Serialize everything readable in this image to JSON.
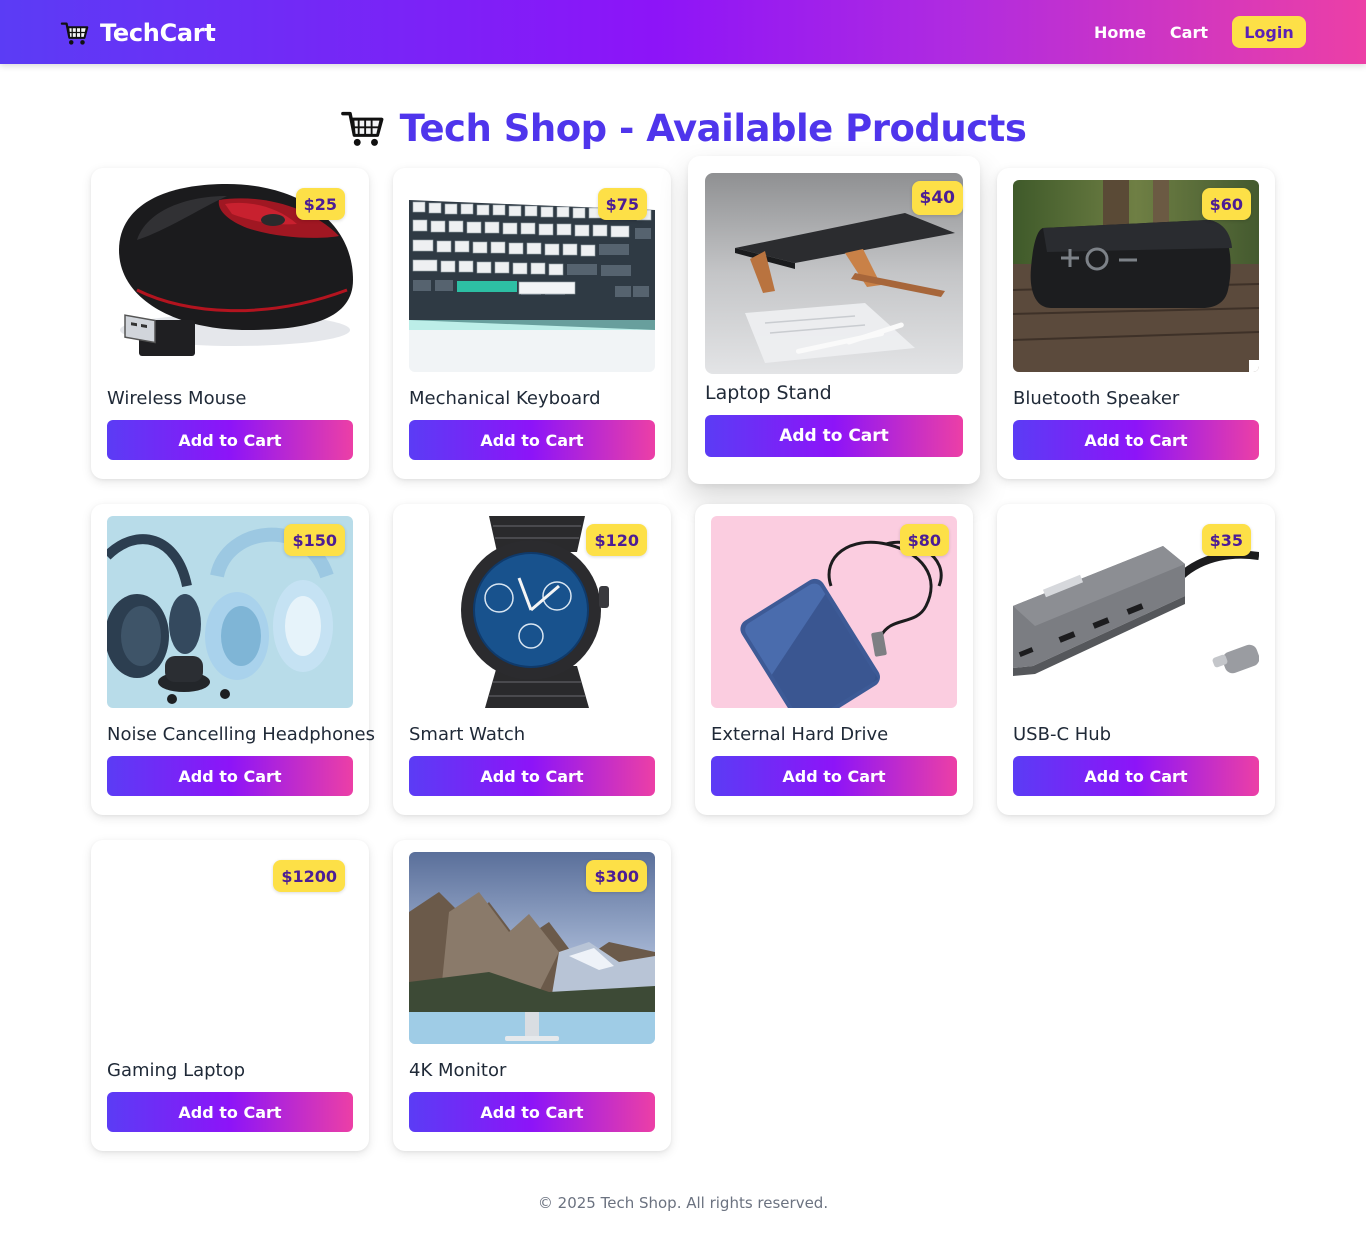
{
  "navbar": {
    "brand": "TechCart",
    "links": {
      "home": "Home",
      "cart": "Cart"
    },
    "login_label": "Login"
  },
  "page": {
    "title": "Tech Shop - Available Products"
  },
  "add_to_cart_label": "Add to Cart",
  "products": [
    {
      "name": "Wireless Mouse",
      "price": "$25"
    },
    {
      "name": "Mechanical Keyboard",
      "price": "$75"
    },
    {
      "name": "Laptop Stand",
      "price": "$40"
    },
    {
      "name": "Bluetooth Speaker",
      "price": "$60"
    },
    {
      "name": "Noise Cancelling Headphones",
      "price": "$150"
    },
    {
      "name": "Smart Watch",
      "price": "$120"
    },
    {
      "name": "External Hard Drive",
      "price": "$80"
    },
    {
      "name": "USB-C Hub",
      "price": "$35"
    },
    {
      "name": "Gaming Laptop",
      "price": "$1200"
    },
    {
      "name": "4K Monitor",
      "price": "$300"
    }
  ],
  "footer": {
    "text": "© 2025 Tech Shop. All rights reserved."
  },
  "colors": {
    "brand_purple": "#5b3cf5",
    "brand_violet": "#8d14f8",
    "brand_pink": "#ec3fa6",
    "price_badge": "#fde047",
    "title_color": "#4f35ec"
  },
  "icons": {
    "brand": "shopping-cart-icon",
    "title": "shopping-cart-icon"
  }
}
